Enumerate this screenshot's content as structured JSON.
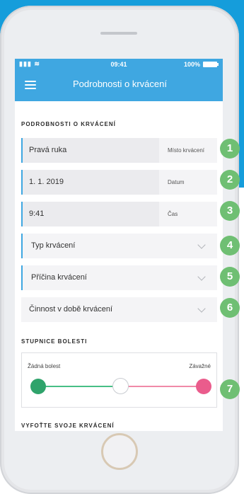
{
  "statusbar": {
    "time": "09:41",
    "battery": "100%"
  },
  "appbar": {
    "title": "Podrobnosti o krvácení"
  },
  "bleeding_details": {
    "section_title": "PODROBNOSTI O KRVÁCENÍ",
    "location": {
      "value": "Pravá ruka",
      "label": "Místo krvácení"
    },
    "date": {
      "value": "1. 1. 2019",
      "label": "Datum"
    },
    "time": {
      "value": "9:41",
      "label": "Čas"
    },
    "type_placeholder": "Typ krvácení",
    "cause_placeholder": "Příčina krvácení",
    "activity_placeholder": "Činnost v době krvácení"
  },
  "pain_scale": {
    "section_title": "STUPNICE BOLESTI",
    "min_label": "Žádná bolest",
    "max_label": "Závažné"
  },
  "photo_section": {
    "title": "VYFOŤTE SVOJE KRVÁCENÍ"
  },
  "badges": [
    "1",
    "2",
    "3",
    "4",
    "5",
    "6",
    "7"
  ],
  "colors": {
    "accent_blue": "#3fa7e1",
    "badge_green": "#6fbf73",
    "pain_low": "#2fa36b",
    "pain_high": "#ea5c8c"
  }
}
